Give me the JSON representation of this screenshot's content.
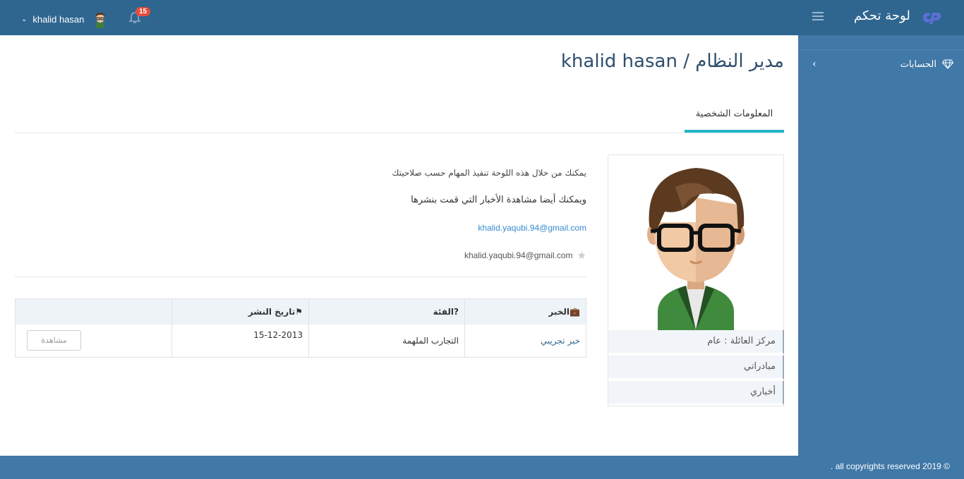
{
  "header": {
    "user_name": "khalid hasan",
    "notifications_count": "15",
    "brand_title": "لوحة تحكم",
    "icons": [
      "chevron-down-icon",
      "avatar",
      "bell-icon",
      "hamburger-icon",
      "cp-logo-icon"
    ]
  },
  "sidebar": {
    "items": [
      {
        "label": "الحسابات",
        "icon": "diamond-icon"
      }
    ]
  },
  "main": {
    "page_title": "مدير النظام / khalid hasan",
    "tab_label": "المعلومات الشخصية",
    "info_line_1": "يمكنك من خلال هذه اللوحة تنفيذ المهام حسب صلاحيتك",
    "info_line_2": "ويمكنك أيضا مشاهدة الأخبار التي قمت بنشرها",
    "email_link": "khalid.yaqubi.94@gmail.com",
    "email_starred": "khalid.yaqubi.94@gmail.com",
    "profile_menu": [
      "مركز العائلة : عام",
      "مبادراتي",
      "أخباري"
    ],
    "table": {
      "headers": [
        "الخبر",
        "الفئة",
        "تاريخ النشر",
        ""
      ],
      "rows": [
        {
          "title": "خبر تجريبي",
          "category": "التجارب الملهمة",
          "date": "15-12-2013",
          "action": "مشاهدة"
        }
      ]
    }
  },
  "footer": {
    "copyright": "© all copyrights reserved 2019 ."
  },
  "colors": {
    "header_bg": "#2f6690",
    "sidebar_bg": "#4078a8",
    "accent": "#1fb5c8",
    "badge": "#e74c3c"
  }
}
